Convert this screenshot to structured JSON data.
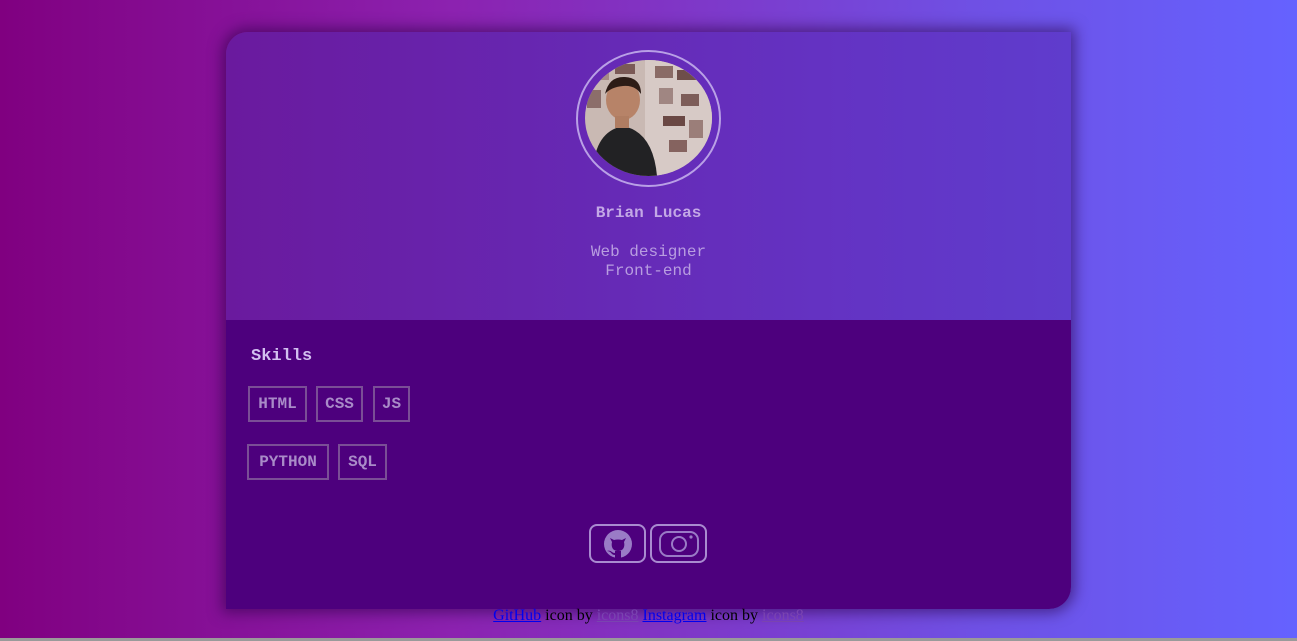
{
  "profile": {
    "name": "Brian Lucas",
    "role_line1": "Web designer",
    "role_line2": "Front-end"
  },
  "skills": {
    "title": "Skills",
    "items": [
      "HTML",
      "CSS",
      "JS",
      "PYTHON",
      "SQL"
    ]
  },
  "social": [
    {
      "icon": "github-icon"
    },
    {
      "icon": "instagram-icon"
    }
  ],
  "footer": {
    "github_link": "GitHub",
    "instagram_link": "Instagram",
    "icon_by": " icon by ",
    "credit": "icons8"
  },
  "colors": {
    "background_start": "#800080",
    "background_end": "#6562ff",
    "card_bottom": "#4d007d",
    "text_accent": "#c3a8e6"
  }
}
